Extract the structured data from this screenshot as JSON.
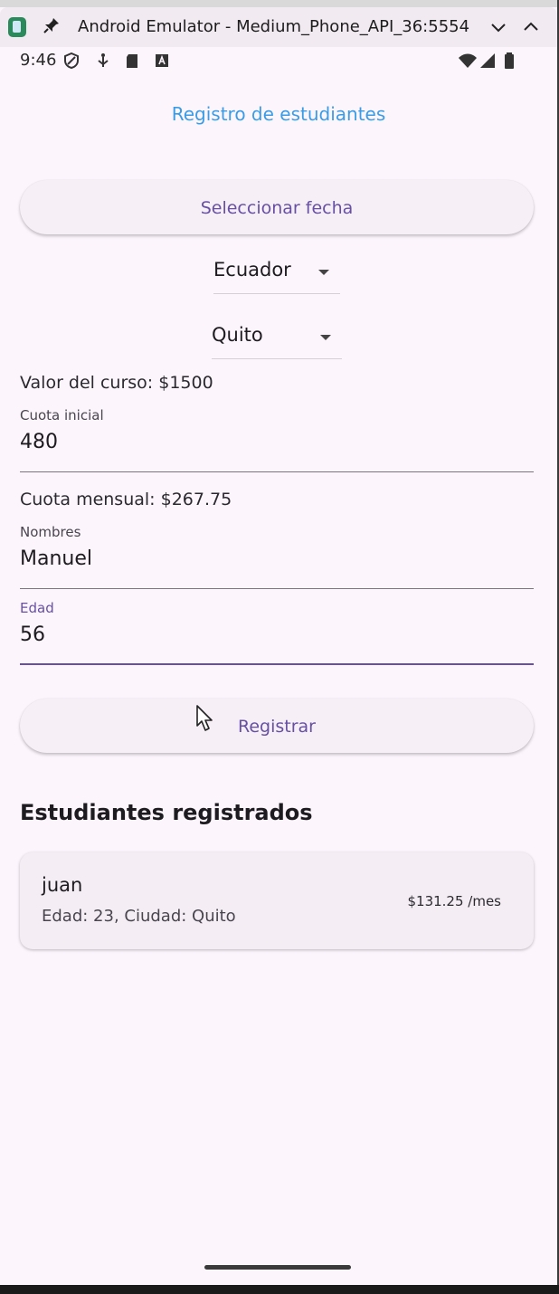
{
  "window": {
    "title": "Android Emulator - Medium_Phone_API_36:5554",
    "icons": [
      "emulator-app-icon",
      "pin-icon",
      "chevron-down-icon",
      "chevron-up-icon"
    ]
  },
  "status_bar": {
    "time": "9:46",
    "icons": [
      "shield-icon",
      "usb-debug-icon",
      "sd-card-icon",
      "keyboard-a-icon",
      "wifi-icon",
      "signal-icon",
      "battery-icon"
    ]
  },
  "app": {
    "title": "Registro de estudiantes",
    "date_button_label": "Seleccionar fecha",
    "country_dropdown": {
      "value": "Ecuador"
    },
    "city_dropdown": {
      "value": "Quito"
    },
    "course_value_text": "Valor del curso: $1500",
    "initial_fee": {
      "label": "Cuota inicial",
      "value": "480"
    },
    "monthly_fee_text": "Cuota mensual: $267.75",
    "names": {
      "label": "Nombres",
      "value": "Manuel"
    },
    "age": {
      "label": "Edad",
      "value": "56"
    },
    "register_button_label": "Registrar",
    "students_heading": "Estudiantes registrados",
    "students": [
      {
        "name": "juan",
        "details": "Edad: 23, Ciudad: Quito",
        "monthly": "$131.25 /mes"
      }
    ]
  },
  "colors": {
    "accent": "#6750a4",
    "title_blue": "#3b9ce6",
    "background": "#fcf5fc"
  }
}
